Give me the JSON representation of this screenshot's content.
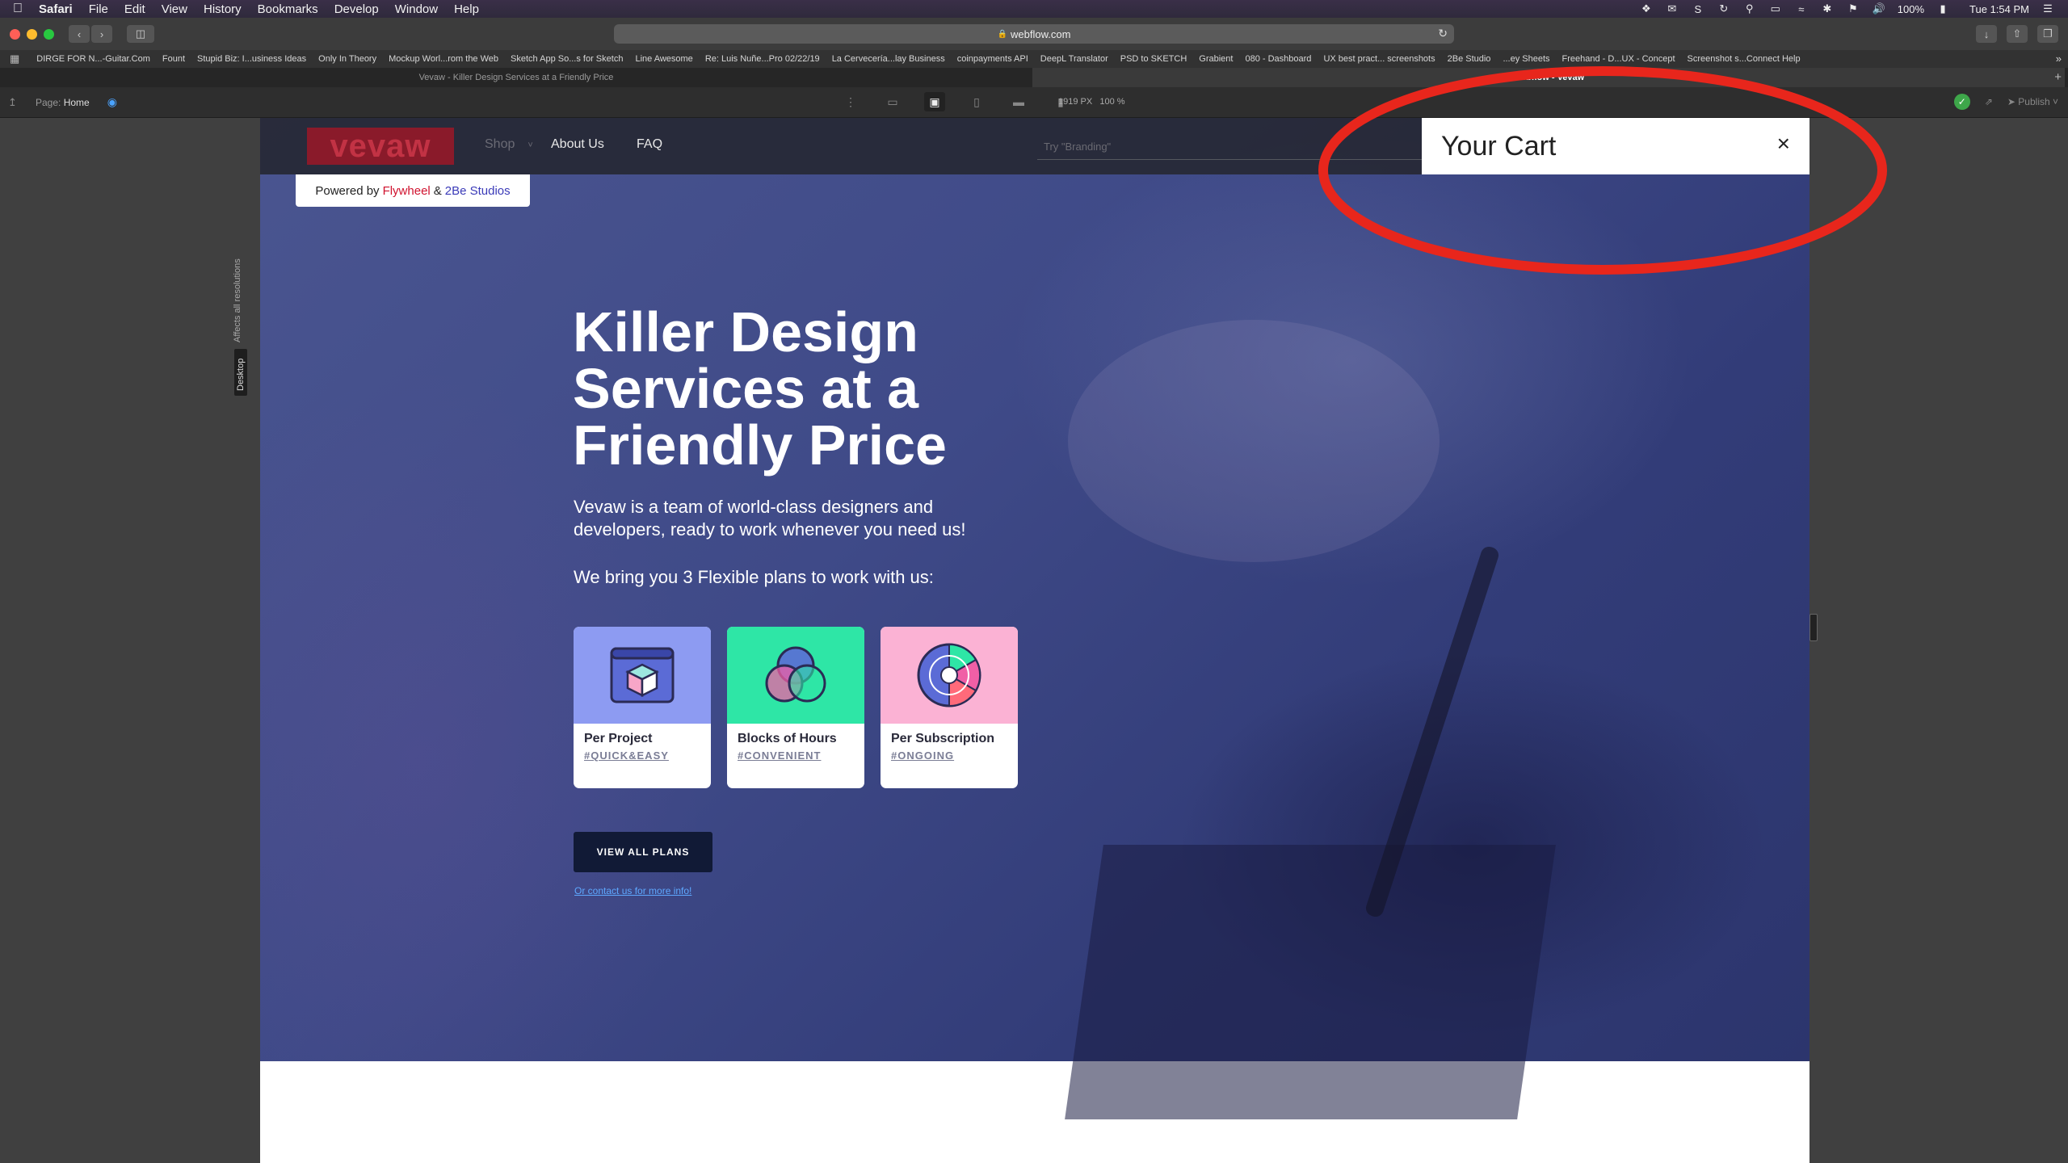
{
  "menubar": {
    "app": "Safari",
    "menus": [
      "File",
      "Edit",
      "View",
      "History",
      "Bookmarks",
      "Develop",
      "Window",
      "Help"
    ],
    "battery": "100%",
    "clock": "Tue 1:54 PM"
  },
  "browser": {
    "url": "webflow.com",
    "bookmarks": [
      "DIRGE FOR N...-Guitar.Com",
      "Fount",
      "Stupid Biz: I...usiness Ideas",
      "Only In Theory",
      "Mockup Worl...rom the Web",
      "Sketch App So...s for Sketch",
      "Line Awesome",
      "Re: Luis Nuñe...Pro 02/22/19",
      "La Cervecería...lay Business",
      "coinpayments API",
      "DeepL Translator",
      "PSD to SKETCH",
      "Grabient",
      "080 - Dashboard",
      "UX best pract... screenshots",
      "2Be Studio",
      "...ey Sheets",
      "Freehand - D...UX - Concept",
      "Screenshot s...Connect Help"
    ],
    "tabs": [
      {
        "label": "Vevaw - Killer Design Services at a Friendly Price",
        "active": false
      },
      {
        "label": "Webflow - Vevaw",
        "active": true
      }
    ]
  },
  "designer": {
    "page_prefix": "Page:",
    "page_name": "Home",
    "width_px": "1919 PX",
    "zoom": "100 %",
    "publish": "Publish",
    "side_note": "Affects all resolutions",
    "breakpoint": "Desktop"
  },
  "site": {
    "logo": "vevaw",
    "nav": {
      "shop": "Shop",
      "about": "About Us",
      "faq": "FAQ"
    },
    "search_placeholder": "Try \"Branding\"",
    "powered": {
      "prefix": "Powered by",
      "flywheel": "Flywheel",
      "amp": "&",
      "studio": "2Be Studios"
    },
    "cart": {
      "title": "Your Cart",
      "close": "×"
    },
    "hero": {
      "title": "Killer Design Services at a Friendly Price",
      "description": "Vevaw is a team of world-class designers and developers, ready to work whenever you need us!",
      "plans_intro": "We bring you 3 Flexible plans to work with us:",
      "plans": [
        {
          "name": "Per Project",
          "tag": "#QUICK&EASY",
          "color": "#8d9bf2"
        },
        {
          "name": "Blocks of Hours",
          "tag": "#CONVENIENT",
          "color": "#2ee6a6"
        },
        {
          "name": "Per Subscription",
          "tag": "#ONGOING",
          "color": "#fbb2d4"
        }
      ],
      "cta": "VIEW ALL PLANS",
      "contact": "Or contact us for more info!"
    }
  },
  "colors": {
    "accent_blue": "#4aa3ff",
    "annotation_red": "#e8261c",
    "cta_bg": "#111a36"
  }
}
